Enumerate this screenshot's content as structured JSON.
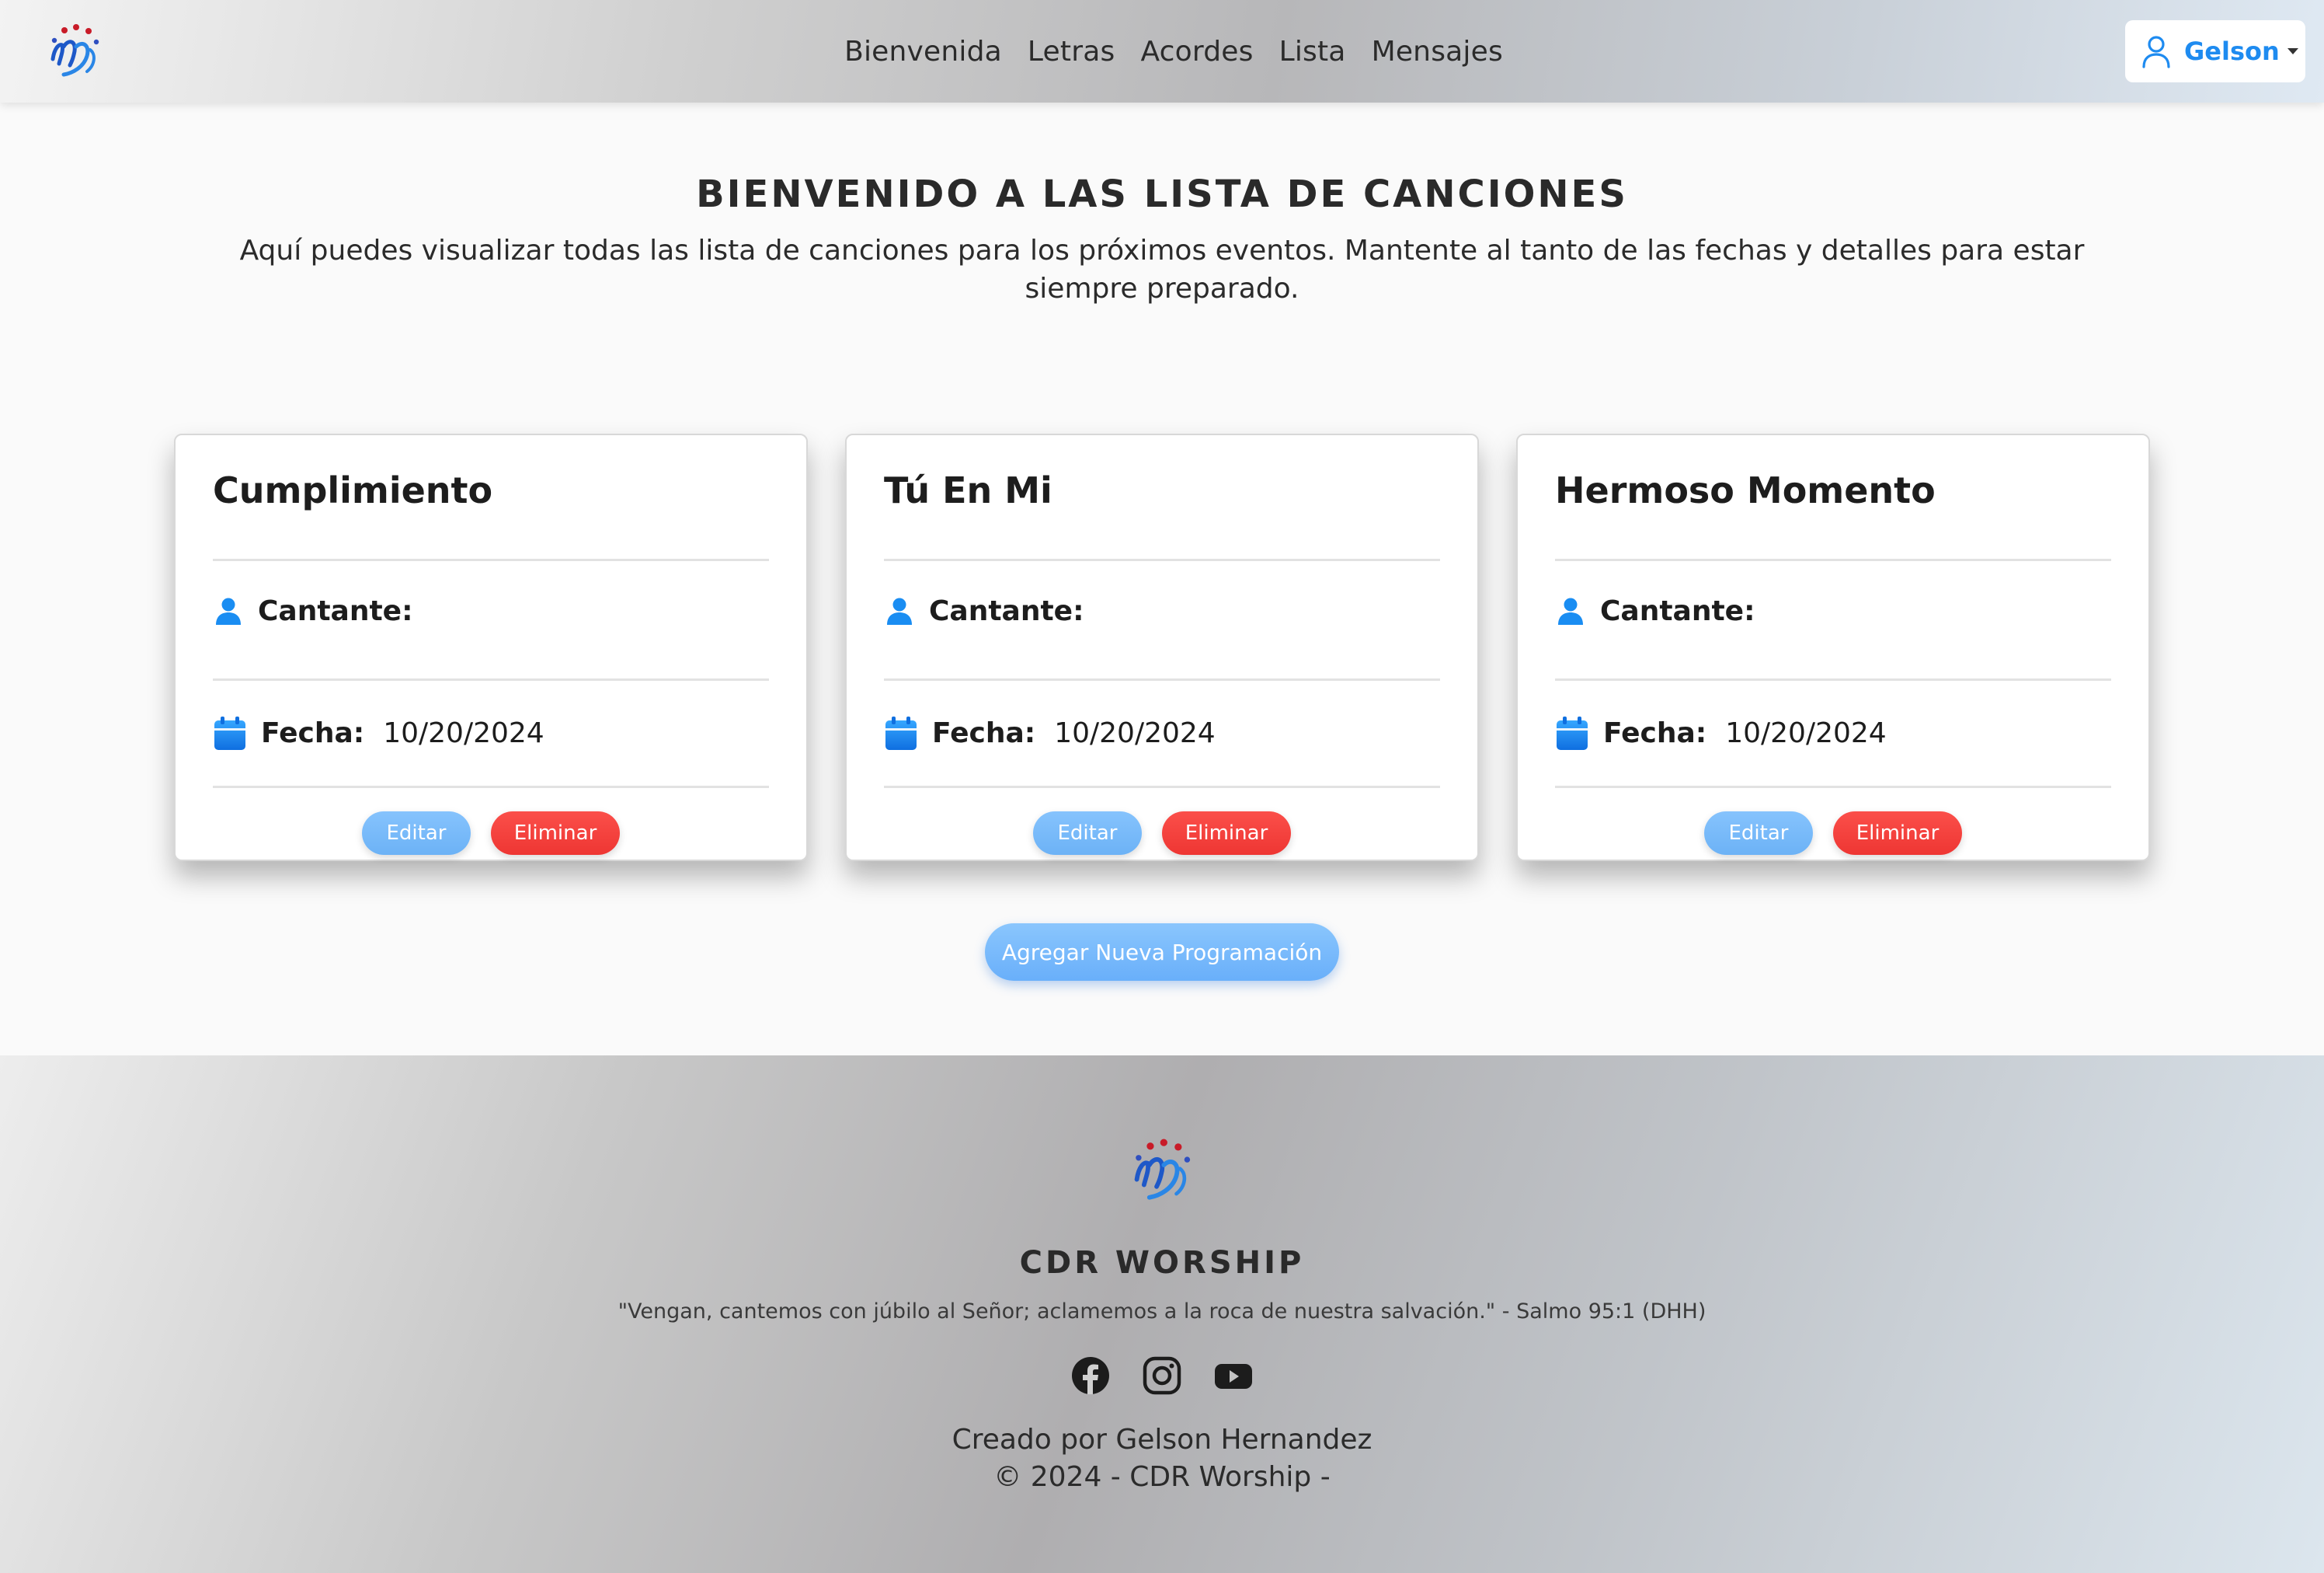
{
  "nav": {
    "logo_icon": "cdr-worship-logo",
    "links": [
      "Bienvenida",
      "Letras",
      "Acordes",
      "Lista",
      "Mensajes"
    ],
    "user": {
      "icon": "user-icon",
      "name": "Gelson"
    }
  },
  "header": {
    "title": "BIENVENIDO A LAS LISTA DE CANCIONES",
    "subtitle": "Aquí puedes visualizar todas las lista de canciones para los próximos eventos. Mantente al tanto de las fechas y detalles para estar siempre preparado."
  },
  "cards": [
    {
      "title": "Cumplimiento",
      "singer_label": "Cantante:",
      "singer": "",
      "date_label": "Fecha:",
      "date": "10/20/2024",
      "edit": "Editar",
      "delete": "Eliminar"
    },
    {
      "title": "Tú En Mi",
      "singer_label": "Cantante:",
      "singer": "",
      "date_label": "Fecha:",
      "date": "10/20/2024",
      "edit": "Editar",
      "delete": "Eliminar"
    },
    {
      "title": "Hermoso Momento",
      "singer_label": "Cantante:",
      "singer": "",
      "date_label": "Fecha:",
      "date": "10/20/2024",
      "edit": "Editar",
      "delete": "Eliminar"
    }
  ],
  "add_button": "Agregar Nueva Programación",
  "footer": {
    "brand": "CDR WORSHIP",
    "quote": "\"Vengan, cantemos con júbilo al Señor; aclamemos a la roca de nuestra salvación.\" - Salmo 95:1 (DHH)",
    "social_icons": [
      "facebook-icon",
      "instagram-icon",
      "youtube-icon"
    ],
    "credit": "Creado por Gelson Hernandez",
    "copyright": "© 2024 - CDR Worship -"
  },
  "colors": {
    "accent_blue": "#1e8bf0",
    "edit_button": "#74b8f9",
    "delete_button": "#f44240",
    "icon_blue": "#1a8df2"
  }
}
